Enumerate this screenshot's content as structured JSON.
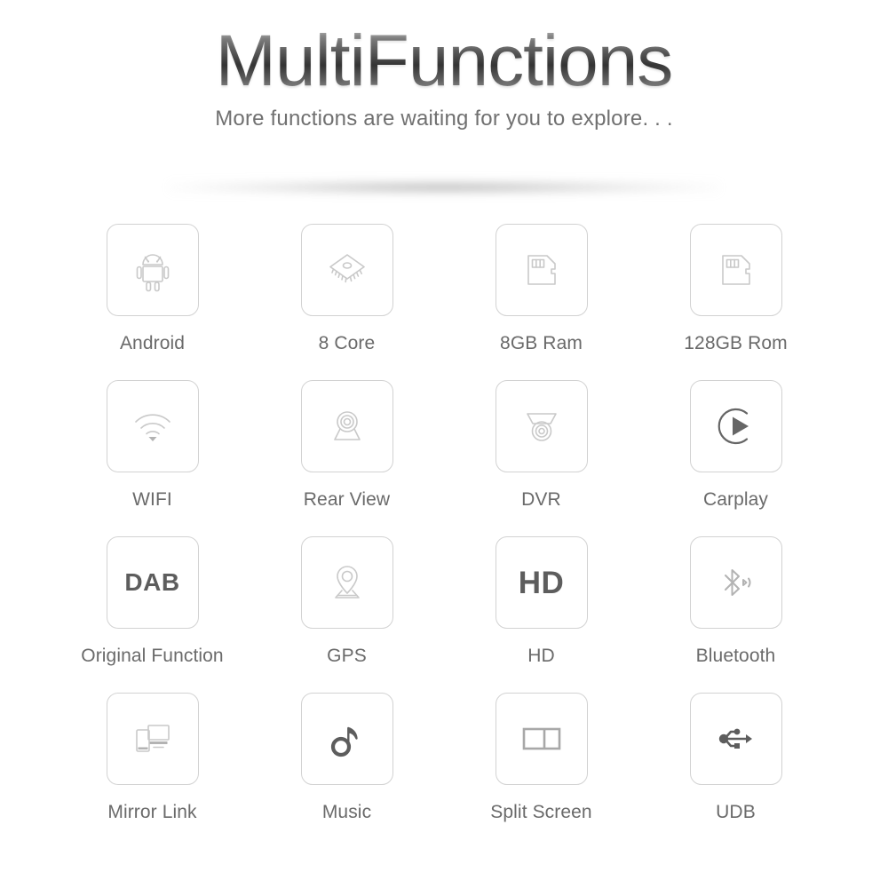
{
  "header": {
    "title": "MultiFunctions",
    "subtitle": "More functions are waiting for you to explore. . ."
  },
  "colors": {
    "tile_border": "#d2d2d2",
    "icon_line": "#c9c9c9",
    "icon_dark": "#5d5d5d",
    "label_text": "#6a6a6a",
    "subtitle_text": "#707070",
    "background": "#ffffff"
  },
  "features": [
    {
      "label": "Android",
      "icon": "android-robot-icon",
      "text": ""
    },
    {
      "label": "8 Core",
      "icon": "cpu-chip-icon",
      "text": ""
    },
    {
      "label": "8GB Ram",
      "icon": "memory-card-icon",
      "text": ""
    },
    {
      "label": "128GB Rom",
      "icon": "memory-card-icon",
      "text": ""
    },
    {
      "label": "WIFI",
      "icon": "wifi-icon",
      "text": ""
    },
    {
      "label": "Rear View",
      "icon": "rear-camera-icon",
      "text": ""
    },
    {
      "label": "DVR",
      "icon": "dome-camera-icon",
      "text": ""
    },
    {
      "label": "Carplay",
      "icon": "play-circle-icon",
      "text": ""
    },
    {
      "label": "Original Function",
      "icon": "dab-text-icon",
      "text": "DAB"
    },
    {
      "label": "GPS",
      "icon": "map-pin-icon",
      "text": ""
    },
    {
      "label": "HD",
      "icon": "hd-text-icon",
      "text": "HD"
    },
    {
      "label": "Bluetooth",
      "icon": "bluetooth-icon",
      "text": ""
    },
    {
      "label": "Mirror Link",
      "icon": "mirror-link-icon",
      "text": ""
    },
    {
      "label": "Music",
      "icon": "music-note-icon",
      "text": ""
    },
    {
      "label": "Split Screen",
      "icon": "split-screen-icon",
      "text": ""
    },
    {
      "label": "UDB",
      "icon": "usb-icon",
      "text": ""
    }
  ]
}
